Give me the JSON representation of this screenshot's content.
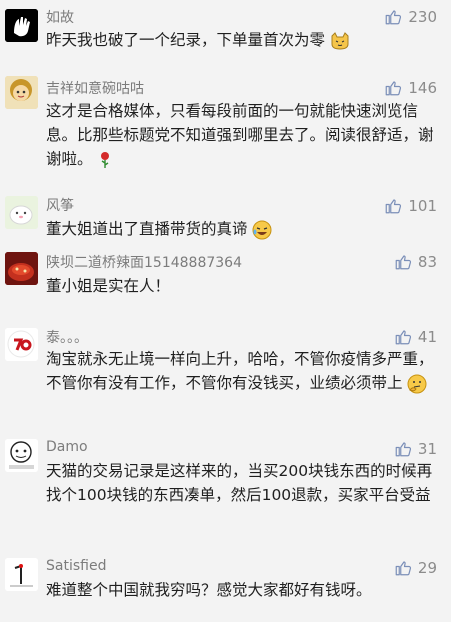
{
  "comments": [
    {
      "name": "如故",
      "likes": "230",
      "text": "昨天我也破了一个纪录，下单量首次为零"
    },
    {
      "name": "吉祥如意碗咕咕",
      "likes": "146",
      "text": "这才是合格媒体，只看每段前面的一句就能快速浏览信息。比那些标题党不知道强到哪里去了。阅读很舒适，谢谢啦。"
    },
    {
      "name": "风筝",
      "likes": "101",
      "text": "董大姐道出了直播带货的真谛"
    },
    {
      "name": "陕坝二道桥辣面15148887364",
      "likes": "83",
      "text": "董小姐是实在人！"
    },
    {
      "name": "泰。。。",
      "likes": "41",
      "text": "淘宝就永无止境一样向上升，哈哈，不管你疫情多严重，不管你有没有工作，不管你有没钱买，业绩必须带上"
    },
    {
      "name": "Damo",
      "likes": "31",
      "text": "天猫的交易记录是这样来的，当买200块钱东西的时候再找个100块钱的东西凑单，然后100退款，买家平台受益"
    },
    {
      "name": "Satisfied",
      "likes": "29",
      "text": "难道整个中国就我穷吗？感觉大家都好有钱呀。"
    }
  ]
}
